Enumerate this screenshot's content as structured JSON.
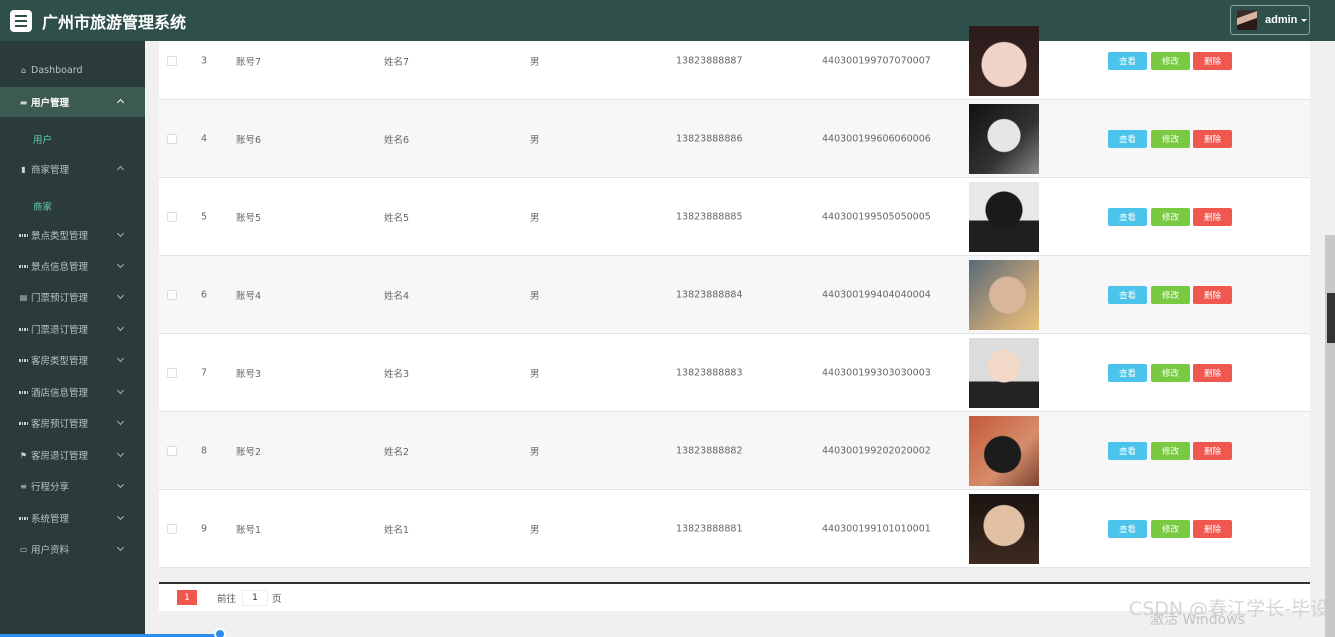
{
  "header": {
    "title": "广州市旅游管理系统",
    "user": "admin"
  },
  "sidebar": {
    "items": [
      {
        "label": "Dashboard",
        "icon": "home-icon"
      },
      {
        "label": "用户管理",
        "icon": "briefcase-icon"
      },
      {
        "label": "商家管理",
        "icon": "building-icon"
      },
      {
        "label": "景点类型管理",
        "icon": "grid-icon"
      },
      {
        "label": "景点信息管理",
        "icon": "grid-icon"
      },
      {
        "label": "门票预订管理",
        "icon": "book-icon"
      },
      {
        "label": "门票退订管理",
        "icon": "grid-icon"
      },
      {
        "label": "客房类型管理",
        "icon": "grid-icon"
      },
      {
        "label": "酒店信息管理",
        "icon": "grid-icon"
      },
      {
        "label": "客房预订管理",
        "icon": "grid-icon"
      },
      {
        "label": "客房退订管理",
        "icon": "flag-icon"
      },
      {
        "label": "行程分享",
        "icon": "sliders-icon"
      },
      {
        "label": "系统管理",
        "icon": "grid-icon"
      },
      {
        "label": "用户资料",
        "icon": "card-icon"
      }
    ],
    "sub_user": "用户",
    "sub_merchant": "商家"
  },
  "table": {
    "rows": [
      {
        "index": "3",
        "account": "账号7",
        "name": "姓名7",
        "gender": "男",
        "phone": "13823888887",
        "idcard": "440300199707070007"
      },
      {
        "index": "4",
        "account": "账号6",
        "name": "姓名6",
        "gender": "男",
        "phone": "13823888886",
        "idcard": "440300199606060006"
      },
      {
        "index": "5",
        "account": "账号5",
        "name": "姓名5",
        "gender": "男",
        "phone": "13823888885",
        "idcard": "440300199505050005"
      },
      {
        "index": "6",
        "account": "账号4",
        "name": "姓名4",
        "gender": "男",
        "phone": "13823888884",
        "idcard": "440300199404040004"
      },
      {
        "index": "7",
        "account": "账号3",
        "name": "姓名3",
        "gender": "男",
        "phone": "13823888883",
        "idcard": "440300199303030003"
      },
      {
        "index": "8",
        "account": "账号2",
        "name": "姓名2",
        "gender": "男",
        "phone": "13823888882",
        "idcard": "440300199202020002"
      },
      {
        "index": "9",
        "account": "账号1",
        "name": "姓名1",
        "gender": "男",
        "phone": "13823888881",
        "idcard": "440300199101010001"
      }
    ],
    "btn_view": "查看",
    "btn_edit": "修改",
    "btn_delete": "删除"
  },
  "pager": {
    "current": "1",
    "goto_label": "前往",
    "goto_value": "1",
    "unit": "页"
  },
  "overlay": {
    "watermark": "CSDN @春江学长-毕设",
    "activate": "激活 Windows"
  }
}
